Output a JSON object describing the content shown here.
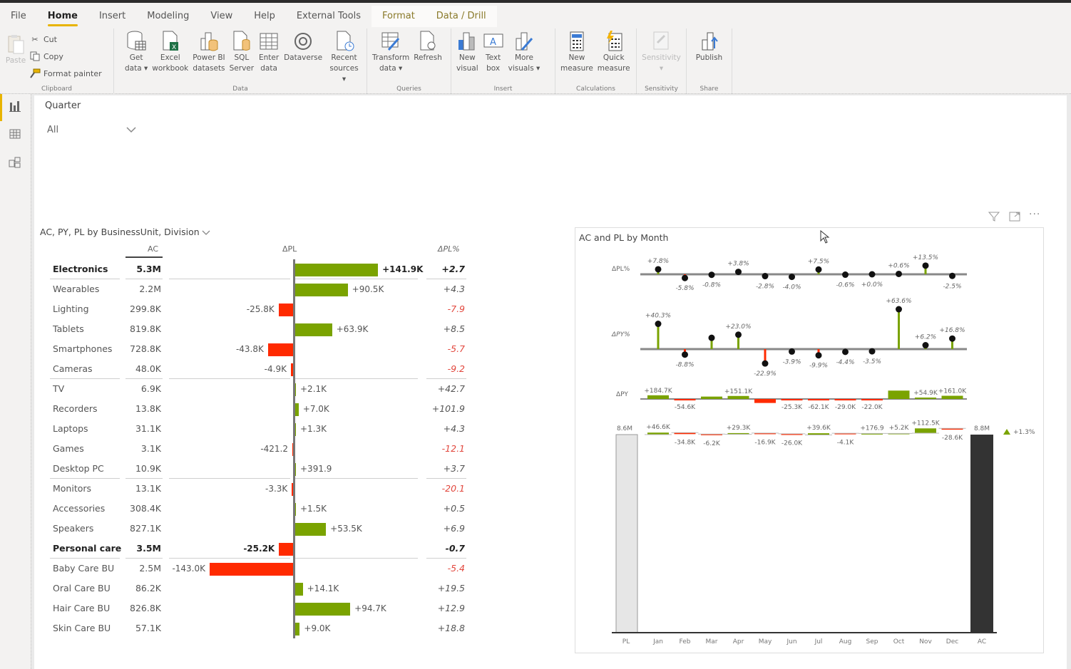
{
  "ribbon": {
    "tabs": [
      {
        "label": "File",
        "active": false,
        "contextual": false
      },
      {
        "label": "Home",
        "active": true,
        "contextual": false
      },
      {
        "label": "Insert",
        "active": false,
        "contextual": false
      },
      {
        "label": "Modeling",
        "active": false,
        "contextual": false
      },
      {
        "label": "View",
        "active": false,
        "contextual": false
      },
      {
        "label": "Help",
        "active": false,
        "contextual": false
      },
      {
        "label": "External Tools",
        "active": false,
        "contextual": false
      },
      {
        "label": "Format",
        "active": false,
        "contextual": true
      },
      {
        "label": "Data / Drill",
        "active": false,
        "contextual": true
      }
    ],
    "clipboard": {
      "label": "Clipboard",
      "paste": "Paste",
      "cut": "Cut",
      "copy": "Copy",
      "format_painter": "Format painter"
    },
    "data_group": {
      "label": "Data",
      "buttons": [
        "Get\ndata ▾",
        "Excel\nworkbook",
        "Power BI\ndatasets",
        "SQL\nServer",
        "Enter\ndata",
        "Dataverse",
        "Recent\nsources ▾"
      ]
    },
    "queries": {
      "label": "Queries",
      "buttons": [
        "Transform\ndata ▾",
        "Refresh"
      ]
    },
    "insert": {
      "label": "Insert",
      "buttons": [
        "New\nvisual",
        "Text\nbox",
        "More\nvisuals ▾"
      ]
    },
    "calculations": {
      "label": "Calculations",
      "buttons": [
        "New\nmeasure",
        "Quick\nmeasure"
      ]
    },
    "sensitivity": {
      "label": "Sensitivity",
      "buttons": [
        "Sensitivity\n▾"
      ]
    },
    "share": {
      "label": "Share",
      "buttons": [
        "Publish"
      ]
    }
  },
  "leftnav": {
    "items": [
      "report-view",
      "data-view",
      "model-view"
    ]
  },
  "slicer": {
    "title": "Quarter",
    "value": "All"
  },
  "table_visual": {
    "title": "AC, PY, PL by BusinessUnit, Division",
    "headers": {
      "ac": "AC",
      "dpl": "ΔPL",
      "dplpct": "ΔPL%"
    },
    "colors": {
      "positive": "#7aa300",
      "negative": "#ff2a00"
    },
    "rows": [
      {
        "name": "Electronics",
        "ac": "5.3M",
        "dpl": 141.9,
        "dpl_label": "+141.9K",
        "pct": "+2.7",
        "bold": true
      },
      {
        "name": "Wearables",
        "ac": "2.2M",
        "dpl": 90.5,
        "dpl_label": "+90.5K",
        "pct": "+4.3",
        "bold": false
      },
      {
        "name": "Lighting",
        "ac": "299.8K",
        "dpl": -25.8,
        "dpl_label": "-25.8K",
        "pct": "-7.9",
        "bold": false
      },
      {
        "name": "Tablets",
        "ac": "819.8K",
        "dpl": 63.9,
        "dpl_label": "+63.9K",
        "pct": "+8.5",
        "bold": false
      },
      {
        "name": "Smartphones",
        "ac": "728.8K",
        "dpl": -43.8,
        "dpl_label": "-43.8K",
        "pct": "-5.7",
        "bold": false
      },
      {
        "name": "Cameras",
        "ac": "48.0K",
        "dpl": -4.9,
        "dpl_label": "-4.9K",
        "pct": "-9.2",
        "bold": false
      },
      {
        "name": "TV",
        "ac": "6.9K",
        "dpl": 2.1,
        "dpl_label": "+2.1K",
        "pct": "+42.7",
        "bold": false
      },
      {
        "name": "Recorders",
        "ac": "13.8K",
        "dpl": 7.0,
        "dpl_label": "+7.0K",
        "pct": "+101.9",
        "bold": false
      },
      {
        "name": "Laptops",
        "ac": "31.1K",
        "dpl": 1.3,
        "dpl_label": "+1.3K",
        "pct": "+4.3",
        "bold": false
      },
      {
        "name": "Games",
        "ac": "3.1K",
        "dpl": -0.4212,
        "dpl_label": "-421.2",
        "pct": "-12.1",
        "bold": false
      },
      {
        "name": "Desktop PC",
        "ac": "10.9K",
        "dpl": 0.3919,
        "dpl_label": "+391.9",
        "pct": "+3.7",
        "bold": false
      },
      {
        "name": "Monitors",
        "ac": "13.1K",
        "dpl": -3.3,
        "dpl_label": "-3.3K",
        "pct": "-20.1",
        "bold": false
      },
      {
        "name": "Accessories",
        "ac": "308.4K",
        "dpl": 1.5,
        "dpl_label": "+1.5K",
        "pct": "+0.5",
        "bold": false
      },
      {
        "name": "Speakers",
        "ac": "827.1K",
        "dpl": 53.5,
        "dpl_label": "+53.5K",
        "pct": "+6.9",
        "bold": false
      },
      {
        "name": "Personal care",
        "ac": "3.5M",
        "dpl": -25.2,
        "dpl_label": "-25.2K",
        "pct": "-0.7",
        "bold": true
      },
      {
        "name": "Baby Care BU",
        "ac": "2.5M",
        "dpl": -143.0,
        "dpl_label": "-143.0K",
        "pct": "-5.4",
        "bold": false
      },
      {
        "name": "Oral Care BU",
        "ac": "86.2K",
        "dpl": 14.1,
        "dpl_label": "+14.1K",
        "pct": "+19.5",
        "bold": false
      },
      {
        "name": "Hair Care BU",
        "ac": "826.8K",
        "dpl": 94.7,
        "dpl_label": "+94.7K",
        "pct": "+12.9",
        "bold": false
      },
      {
        "name": "Skin Care BU",
        "ac": "57.1K",
        "dpl": 9.0,
        "dpl_label": "+9.0K",
        "pct": "+18.8",
        "bold": false
      }
    ],
    "separators_after": [
      0,
      5,
      10,
      14
    ]
  },
  "chart_data": {
    "type": "bar",
    "title": "AC and PL by Month",
    "categories": [
      "Jan",
      "Feb",
      "Mar",
      "Apr",
      "May",
      "Jun",
      "Jul",
      "Aug",
      "Sep",
      "Oct",
      "Nov",
      "Dec"
    ],
    "axis_labels": [
      "PL",
      "Jan",
      "Feb",
      "Mar",
      "Apr",
      "May",
      "Jun",
      "Jul",
      "Aug",
      "Sep",
      "Oct",
      "Nov",
      "Dec",
      "AC"
    ],
    "dpl_pct": {
      "label": "ΔPL%",
      "values": [
        7.8,
        -5.8,
        -0.8,
        3.8,
        -2.8,
        -4.0,
        7.5,
        -0.6,
        0.0,
        0.6,
        13.5,
        -2.5
      ],
      "labels": [
        "+7.8%",
        "-5.8%",
        "-0.8%",
        "+3.8%",
        "-2.8%",
        "-4.0%",
        "+7.5%",
        "-0.6%",
        "+0.0%",
        "+0.6%",
        "+13.5%",
        "-2.5%"
      ]
    },
    "dpy_pct": {
      "label": "ΔPY%",
      "values": [
        40.3,
        -8.8,
        18.0,
        23.0,
        -22.9,
        -3.9,
        -9.9,
        -4.4,
        -3.5,
        63.6,
        6.2,
        16.8
      ],
      "labels": [
        "+40.3%",
        "-8.8%",
        "",
        "+23.0%",
        "-22.9%",
        "-3.9%",
        "-9.9%",
        "-4.4%",
        "-3.5%",
        "+63.6%",
        "+6.2%",
        "+16.8%"
      ]
    },
    "dpy": {
      "label": "ΔPY",
      "values": [
        184.7,
        -54.6,
        120,
        151.1,
        -200,
        -25.3,
        -62.1,
        -29.0,
        -22.0,
        420,
        54.9,
        161.0
      ],
      "labels": [
        "+184.7K",
        "-54.6K",
        "",
        "+151.1K",
        "",
        "-25.3K",
        "-62.1K",
        "-29.0K",
        "-22.0K",
        "",
        "+54.9K",
        "+161.0K"
      ]
    },
    "waterfall": {
      "start_label": "8.6M",
      "end_label": "8.8M",
      "start_value_m": 8.6,
      "end_value_m": 8.8,
      "deltas_k": [
        46.6,
        -34.8,
        -6.2,
        29.3,
        -16.9,
        -26.0,
        39.6,
        -4.1,
        0.1769,
        5.2,
        112.5,
        -28.6
      ],
      "labels": [
        "+46.6K",
        "-34.8K",
        "-6.2K",
        "+29.3K",
        "-16.9K",
        "-26.0K",
        "+39.6K",
        "-4.1K",
        "+176.9",
        "+5.2K",
        "+112.5K",
        "-28.6K"
      ],
      "total_delta_label": "+1.3%"
    },
    "colors": {
      "positive": "#7aa300",
      "negative": "#ff2a00",
      "dot": "#111111",
      "axis": "#888888",
      "ac_bar": "#333333",
      "pl_bar": "#e6e6e6"
    }
  }
}
